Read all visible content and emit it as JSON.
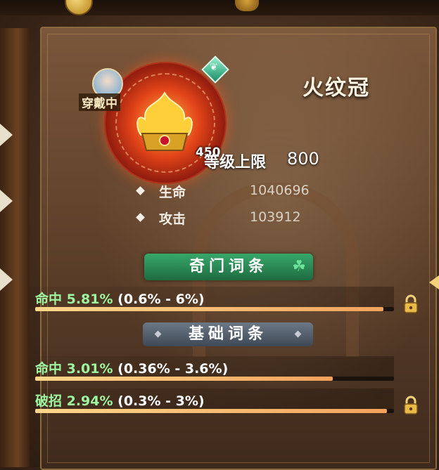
{
  "top": {
    "value_1": "",
    "value_2": ""
  },
  "item": {
    "name": "火纹冠",
    "wearing_label": "穿戴中",
    "level": "450",
    "level_cap_label": "等级上限",
    "level_cap_value": "800"
  },
  "stats": [
    {
      "label": "生命",
      "value": "1040696"
    },
    {
      "label": "攻击",
      "value": "103912"
    }
  ],
  "sections": {
    "special": "奇门词条",
    "basic": "基础词条"
  },
  "special_attrs": [
    {
      "stat": "命中 5.81%",
      "range": "(0.6% - 6%)",
      "fill": 0.97,
      "locked": true
    }
  ],
  "basic_attrs": [
    {
      "stat": "命中 3.01%",
      "range": "(0.36% - 3.6%)",
      "fill": 0.83,
      "locked": false
    },
    {
      "stat": "破招 2.94%",
      "range": "(0.3% - 3%)",
      "fill": 0.98,
      "locked": true
    }
  ],
  "colors": {
    "accent_green": "#9ef5a0",
    "bar": "#f5a25c",
    "banner_green": "#2f8f58",
    "banner_gray": "#56606d"
  },
  "icons": [
    "coin-icon",
    "dragon-currency-icon",
    "crown-emblem-icon",
    "leaf-gem-icon",
    "lock-icon",
    "clover-icon",
    "avatar"
  ]
}
